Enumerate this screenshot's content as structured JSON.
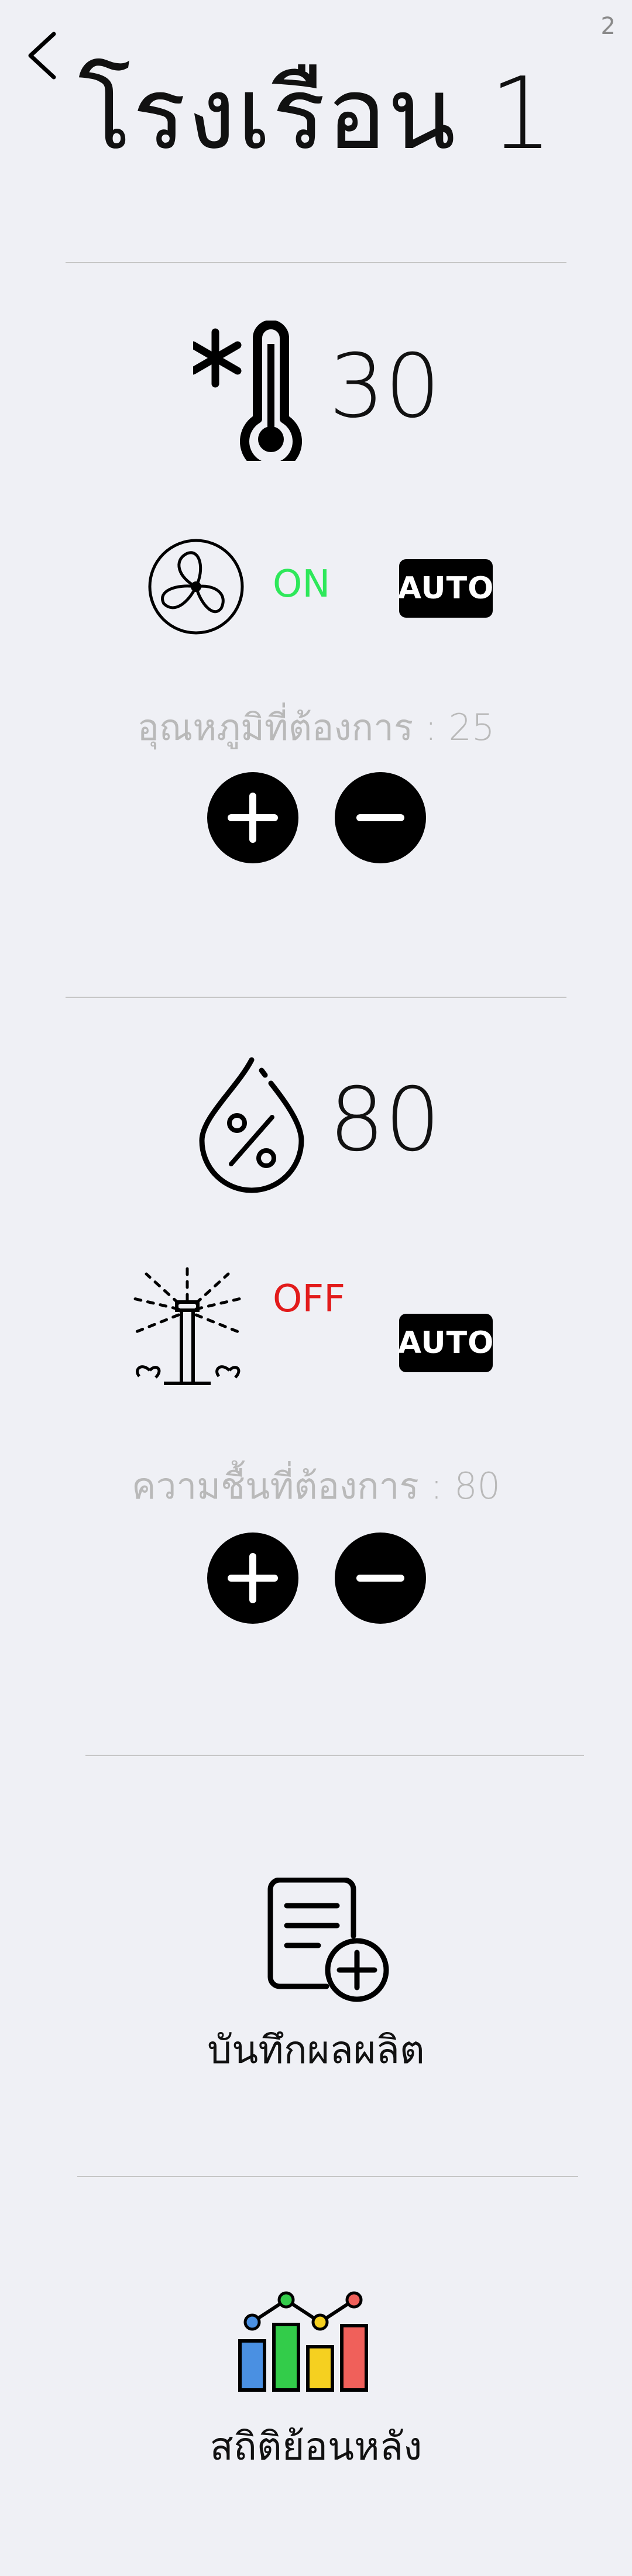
{
  "page_number": "2",
  "header": {
    "title": "โรงเรือน 1"
  },
  "temperature": {
    "icon": "thermometer-snowflake-icon",
    "value": "30",
    "fan": {
      "icon": "fan-icon",
      "state": "ON",
      "state_color": "#2ee85a",
      "mode": "AUTO"
    },
    "target_text": "อุณหภูมิที่ต้องการ : 25"
  },
  "humidity": {
    "icon": "humidity-drop-icon",
    "value": "80",
    "sprinkler": {
      "icon": "sprinkler-icon",
      "state": "OFF",
      "state_color": "#e21b1b",
      "mode": "AUTO"
    },
    "target_text": "ความชื้นที่ต้องการ : 80"
  },
  "menu": {
    "record": {
      "icon": "document-add-icon",
      "label": "บันทึกผลผลิต"
    },
    "history": {
      "icon": "bar-chart-icon",
      "label": "สถิติย้อนหลัง"
    }
  },
  "colors": {
    "background": "#eff0f5",
    "divider": "#c6c6c6",
    "muted_text": "#b9b9b9"
  }
}
